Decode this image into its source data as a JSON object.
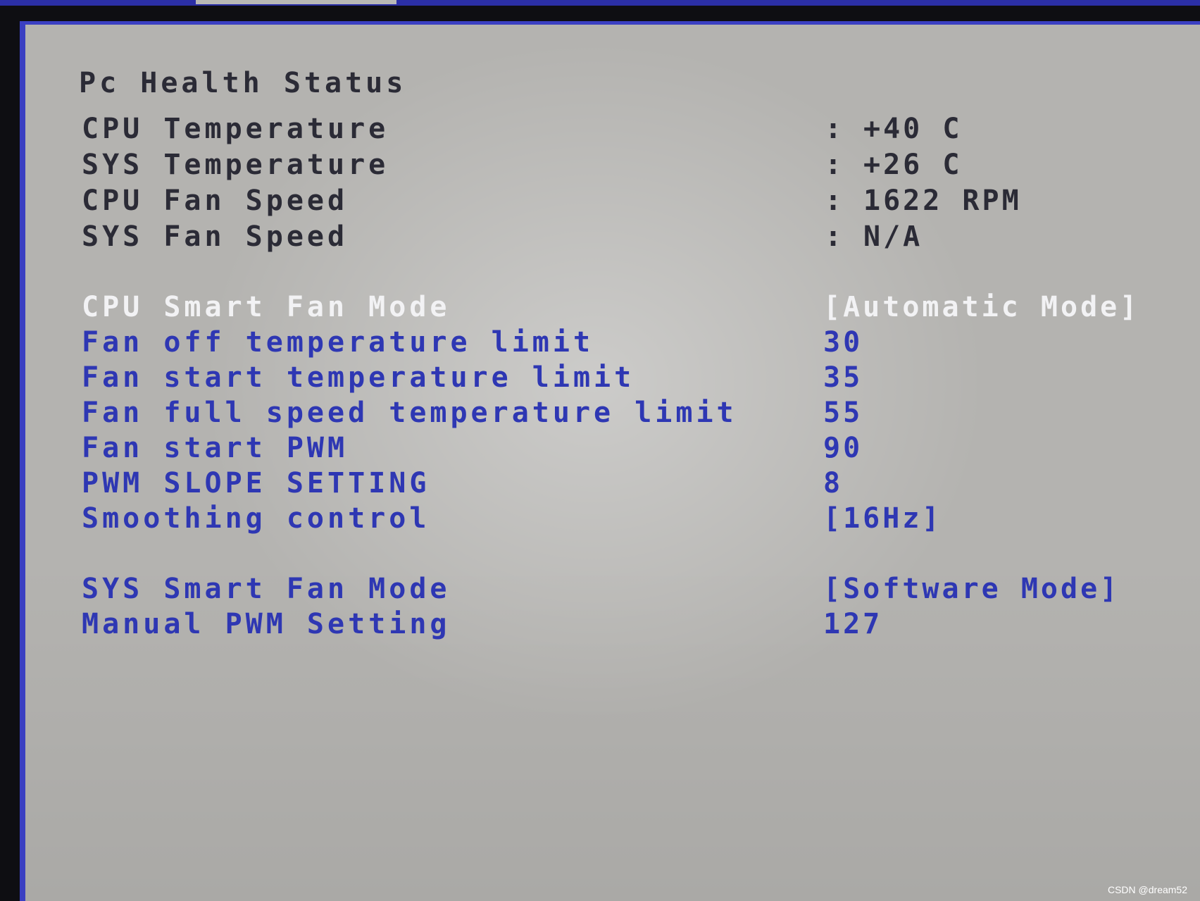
{
  "page": {
    "title": "Pc Health Status"
  },
  "status": [
    {
      "label": "CPU Temperature",
      "value": "+40 C"
    },
    {
      "label": "SYS Temperature",
      "value": "+26 C"
    },
    {
      "label": "CPU Fan Speed",
      "value": "1622 RPM"
    },
    {
      "label": "SYS Fan Speed",
      "value": "N/A"
    }
  ],
  "colon": ":",
  "cpu_fan_settings": [
    {
      "label": "CPU Smart Fan Mode",
      "value": "[Automatic Mode]"
    },
    {
      "label": "Fan off temperature limit",
      "value": "30"
    },
    {
      "label": "Fan start temperature limit",
      "value": "35"
    },
    {
      "label": "Fan full speed temperature limit",
      "value": "55"
    },
    {
      "label": "Fan start PWM",
      "value": "90"
    },
    {
      "label": "PWM SLOPE SETTING",
      "value": "8"
    },
    {
      "label": "Smoothing control",
      "value": "[16Hz]"
    }
  ],
  "sys_fan_settings": [
    {
      "label": "SYS Smart Fan Mode",
      "value": "[Software Mode]"
    },
    {
      "label": "Manual PWM Setting",
      "value": "127"
    }
  ],
  "watermark": "CSDN @dream52",
  "colors": {
    "background": "#b4b3b0",
    "frame": "#3a3fc2",
    "static_text": "#2b2b36",
    "setting_text": "#2e37b3",
    "selected_text": "#f2f2f4"
  }
}
